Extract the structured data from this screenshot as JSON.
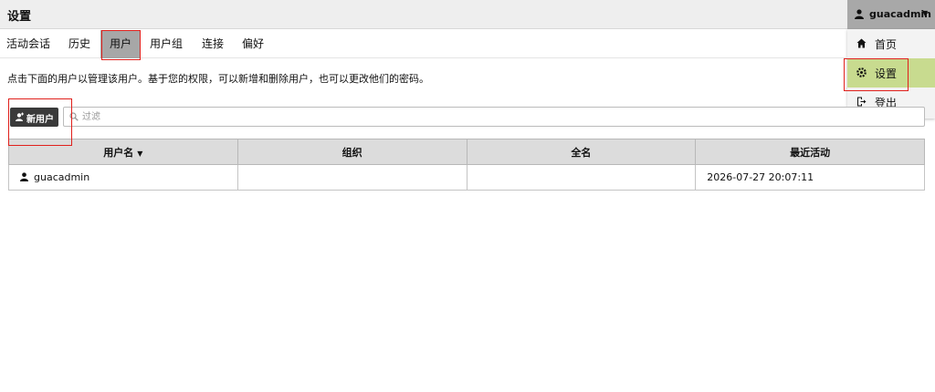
{
  "header": {
    "title": "设置"
  },
  "user_menu": {
    "username": "guacadmin",
    "items": [
      {
        "label": "首页",
        "icon": "home-icon"
      },
      {
        "label": "设置",
        "icon": "settings-icon",
        "active": true
      },
      {
        "label": "登出",
        "icon": "logout-icon"
      }
    ]
  },
  "tabs": [
    {
      "label": "活动会话"
    },
    {
      "label": "历史"
    },
    {
      "label": "用户",
      "active": true
    },
    {
      "label": "用户组"
    },
    {
      "label": "连接"
    },
    {
      "label": "偏好"
    }
  ],
  "description": "点击下面的用户以管理该用户。基于您的权限，可以新增和删除用户，也可以更改他们的密码。",
  "toolbar": {
    "new_user_label": "新用户",
    "filter_placeholder": "过滤",
    "filter_value": ""
  },
  "table": {
    "columns": [
      "用户名",
      "组织",
      "全名",
      "最近活动"
    ],
    "rows": [
      {
        "username": "guacadmin",
        "organization": "",
        "full_name": "",
        "last_active": "2026-07-27 20:07:11"
      }
    ]
  },
  "colors": {
    "active_tab": "#a7a7a7",
    "active_menu": "#c8db8f",
    "highlight_box": "#e0201c",
    "button_bg": "#3a3a3a"
  }
}
